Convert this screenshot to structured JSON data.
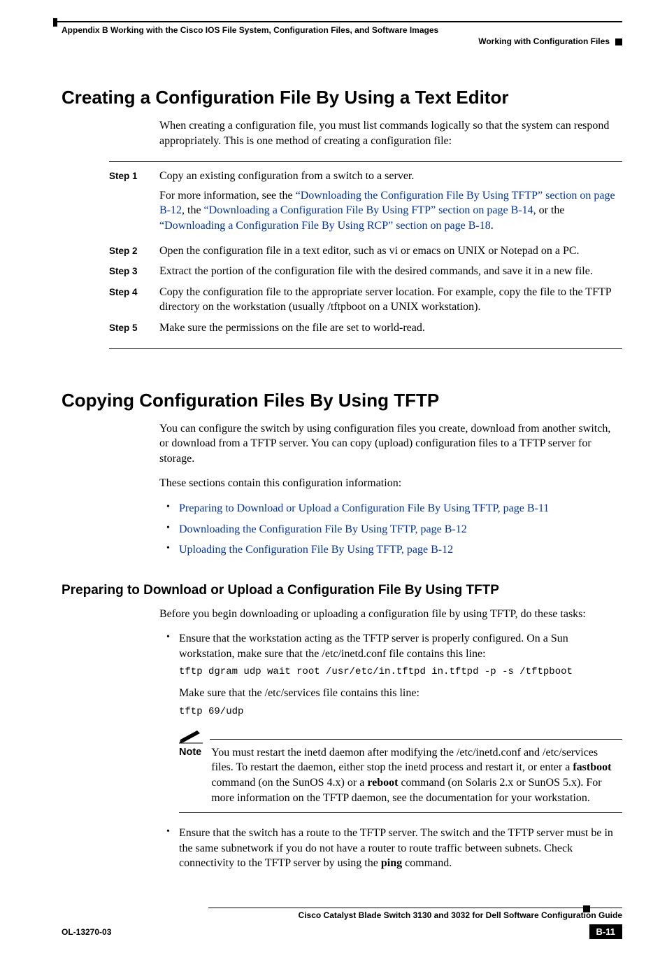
{
  "header": {
    "appendix": "Appendix B      Working with the Cisco IOS File System, Configuration Files, and Software Images",
    "section": "Working with Configuration Files"
  },
  "sec1": {
    "title": "Creating a Configuration File By Using a Text Editor",
    "intro": "When creating a configuration file, you must list commands logically so that the system can respond appropriately. This is one method of creating a configuration file:",
    "steps": [
      {
        "label": "Step 1",
        "p1": "Copy an existing configuration from a switch to a server.",
        "p2a": "For more information, see the ",
        "link1": "“Downloading the Configuration File By Using TFTP” section on page B-12",
        "p2b": ", the ",
        "link2": "“Downloading a Configuration File By Using FTP” section on page B-14",
        "p2c": ", or the ",
        "link3": "“Downloading a Configuration File By Using RCP” section on page B-18",
        "p2d": "."
      },
      {
        "label": "Step 2",
        "text": "Open the configuration file in a text editor, such as vi or emacs on UNIX or Notepad on a PC."
      },
      {
        "label": "Step 3",
        "text": "Extract the portion of the configuration file with the desired commands, and save it in a new file."
      },
      {
        "label": "Step 4",
        "text": "Copy the configuration file to the appropriate server location. For example, copy the file to the TFTP directory on the workstation (usually /tftpboot on a UNIX workstation)."
      },
      {
        "label": "Step 5",
        "text": "Make sure the permissions on the file are set to world-read."
      }
    ]
  },
  "sec2": {
    "title": "Copying Configuration Files By Using TFTP",
    "p1": "You can configure the switch by using configuration files you create, download from another switch, or download from a TFTP server. You can copy (upload) configuration files to a TFTP server for storage.",
    "p2": "These sections contain this configuration information:",
    "links": [
      "Preparing to Download or Upload a Configuration File By Using TFTP, page B-11",
      "Downloading the Configuration File By Using TFTP, page B-12",
      "Uploading the Configuration File By Using TFTP, page B-12"
    ]
  },
  "sec3": {
    "title": "Preparing to Download or Upload a Configuration File By Using TFTP",
    "intro": "Before you begin downloading or uploading a configuration file by using TFTP, do these tasks:",
    "b1a": "Ensure that the workstation acting as the TFTP server is properly configured. On a Sun workstation, make sure that the /etc/inetd.conf file contains this line:",
    "code1": "tftp dgram udp wait root /usr/etc/in.tftpd in.tftpd -p -s /tftpboot",
    "b1b": "Make sure that the /etc/services file contains this line:",
    "code2": "tftp 69/udp",
    "note_label": "Note",
    "note_a": "You must restart the inetd daemon after modifying the /etc/inetd.conf and /etc/services files. To restart the daemon, either stop the inetd process and restart it, or enter a ",
    "note_bold1": "fastboot",
    "note_b": " command (on the SunOS 4.x) or a ",
    "note_bold2": "reboot",
    "note_c": " command (on Solaris 2.x or SunOS 5.x). For more information on the TFTP daemon, see the documentation for your workstation.",
    "b2a": "Ensure that the switch has a route to the TFTP server. The switch and the TFTP server must be in the same subnetwork if you do not have a router to route traffic between subnets. Check connectivity to the TFTP server by using the ",
    "b2_bold": "ping",
    "b2b": " command."
  },
  "footer": {
    "guide": "Cisco Catalyst Blade Switch 3130 and 3032 for Dell Software Configuration Guide",
    "doc": "OL-13270-03",
    "page": "B-11"
  }
}
